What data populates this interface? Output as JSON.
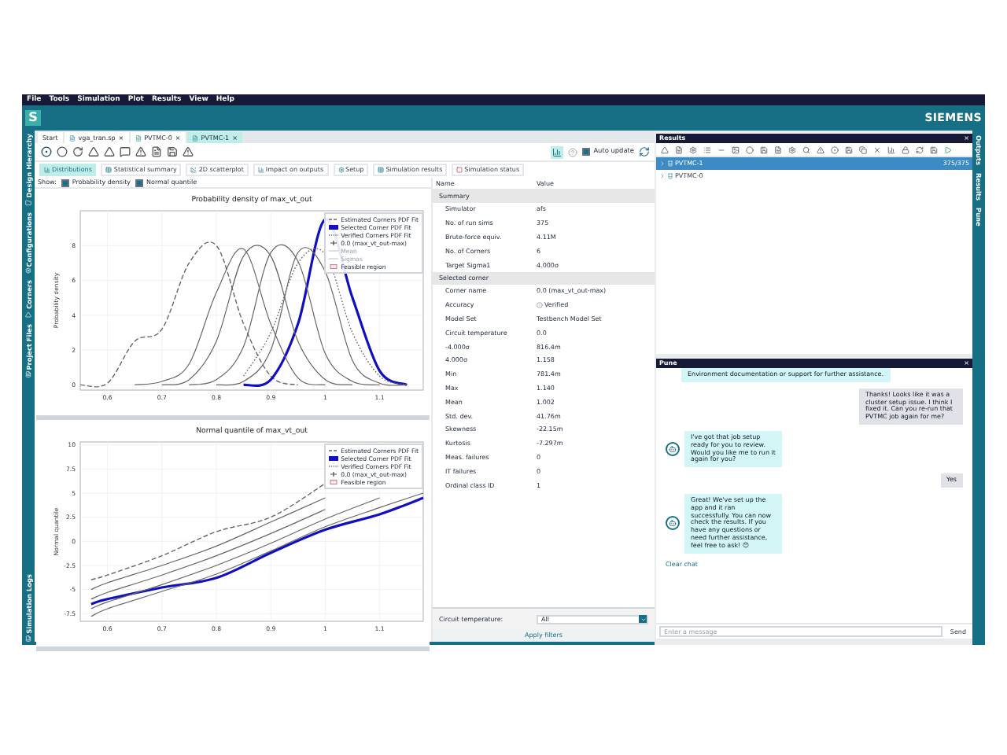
{
  "menu": [
    "File",
    "Tools",
    "Simulation",
    "Plot",
    "Results",
    "View",
    "Help"
  ],
  "header": {
    "logo": "S",
    "brand": "SIEMENS"
  },
  "left_sidebar": [
    "Design Hierarchy",
    "Configurations",
    "Corners",
    "Project Files",
    "Simulation Logs"
  ],
  "right_sidebar": [
    "Outputs",
    "Results",
    "Pune"
  ],
  "doc_tabs": [
    {
      "label": "Start",
      "selected": false
    },
    {
      "label": "vga_tran.sp",
      "close": "×",
      "selected": false
    },
    {
      "label": "PVTMC-0",
      "close": "×",
      "selected": false
    },
    {
      "label": "PVTMC-1",
      "close": "×",
      "selected": true
    }
  ],
  "auto_update": {
    "label": "Auto update",
    "checked": true
  },
  "view_tabs": [
    {
      "label": "Distributions",
      "selected": true
    },
    {
      "label": "Statistical summary",
      "selected": false
    },
    {
      "label": "2D scatterplot",
      "selected": false
    },
    {
      "label": "Impact on outputs",
      "selected": false
    },
    {
      "label": "Setup",
      "selected": false
    },
    {
      "label": "Simulation results",
      "selected": false
    },
    {
      "label": "Simulation status",
      "selected": false
    }
  ],
  "show": {
    "label": "Show:",
    "options": [
      {
        "label": "Probability density",
        "checked": true
      },
      {
        "label": "Normal quantile",
        "checked": true
      }
    ]
  },
  "charts": [
    {
      "chart_data": {
        "type": "line",
        "title": "Probability density of max_vt_out",
        "ylabel": "Probability density",
        "grid": true,
        "x": [
          0.55,
          0.6,
          0.65,
          0.7,
          0.75,
          0.8,
          0.85,
          0.9,
          0.95,
          1.0,
          1.05,
          1.1,
          1.15
        ],
        "xlim": [
          0.55,
          1.18
        ],
        "ylim": [
          -0.3,
          10
        ],
        "xticks": [
          {
            "value": 0.6,
            "label": "0.6"
          },
          {
            "value": 0.7,
            "label": "0.7"
          },
          {
            "value": 0.8,
            "label": "0.8"
          },
          {
            "value": 0.9,
            "label": "0.9"
          },
          {
            "value": 1,
            "label": "1"
          },
          {
            "value": 1.1,
            "label": "1.1"
          }
        ],
        "yticks": [
          0,
          2,
          4,
          6,
          8
        ],
        "series": [
          {
            "name": "Estimated Corners PDF Fit",
            "color": "#666666",
            "line_style": "dashed",
            "values": [
              0,
              0.1,
              2.5,
              3.2,
              7,
              8,
              3.5,
              0.5,
              0,
              null,
              null,
              null,
              null
            ]
          },
          {
            "name": "Selected Corner PDF Fit",
            "color": "#1010c0",
            "line_style": "solid",
            "values": [
              null,
              null,
              null,
              null,
              null,
              null,
              0,
              0.3,
              3.5,
              9.5,
              5,
              0.8,
              0
            ]
          },
          {
            "name": "Verified Corners PDF Fit",
            "color": "#666666",
            "line_style": "dotted",
            "values": [
              null,
              null,
              null,
              null,
              null,
              null,
              0.5,
              3,
              7,
              7.5,
              3,
              0.5,
              0
            ]
          },
          {
            "color": "#666666",
            "line_style": "solid",
            "values": [
              null,
              null,
              0,
              0.2,
              1.2,
              5.3,
              7.8,
              3.5,
              0.4,
              0,
              null,
              null,
              null
            ]
          },
          {
            "color": "#666666",
            "line_style": "solid",
            "values": [
              null,
              null,
              null,
              0,
              0.3,
              2.5,
              7.4,
              7.4,
              2.5,
              0.3,
              0,
              null,
              null
            ]
          },
          {
            "color": "#666666",
            "line_style": "solid",
            "values": [
              null,
              null,
              null,
              null,
              0,
              0.3,
              2.2,
              7.6,
              7.1,
              1.8,
              0.2,
              0,
              null
            ]
          },
          {
            "color": "#666666",
            "line_style": "solid",
            "values": [
              null,
              null,
              null,
              null,
              null,
              0,
              0.2,
              2,
              7.6,
              6.5,
              1.4,
              0.1,
              0
            ]
          }
        ]
      },
      "legend": [
        {
          "label": "0.0 (max_vt_out-max)",
          "kind": "marker"
        },
        {
          "label": "Mean",
          "kind": "faint"
        },
        {
          "label": "Sigmas",
          "kind": "faint"
        },
        {
          "label": "Feasible region",
          "kind": "box"
        }
      ]
    },
    {
      "chart_data": {
        "type": "line",
        "title": "Normal quantile of max_vt_out",
        "ylabel": "Normal quantile",
        "grid": true,
        "x": [
          0.57,
          0.6,
          0.7,
          0.8,
          0.9,
          1.0,
          1.1,
          1.18
        ],
        "xlim": [
          0.55,
          1.18
        ],
        "ylim": [
          -8.3,
          10.3
        ],
        "xticks": [
          {
            "value": 0.6,
            "label": "0.6"
          },
          {
            "value": 0.7,
            "label": "0.7"
          },
          {
            "value": 0.8,
            "label": "0.8"
          },
          {
            "value": 0.9,
            "label": "0.9"
          },
          {
            "value": 1,
            "label": "1"
          },
          {
            "value": 1.1,
            "label": "1.1"
          }
        ],
        "yticks": [
          -7.5,
          -5,
          -2.5,
          0,
          2.5,
          5,
          7.5,
          10
        ],
        "series": [
          {
            "name": "Estimated Corners PDF Fit",
            "color": "#666666",
            "line_style": "dashed",
            "values": [
              -4,
              -3.5,
              -1.5,
              1,
              2.5,
              6,
              null,
              null
            ]
          },
          {
            "name": "Selected Corner PDF Fit",
            "color": "#1010c0",
            "line_style": "solid",
            "values": [
              -6.5,
              -6,
              -4.8,
              -3.8,
              -1.2,
              1.2,
              2.8,
              4.5
            ]
          },
          {
            "color": "#666666",
            "line_style": "solid",
            "values": [
              -5,
              -4.3,
              -2.5,
              -0.5,
              2,
              4.5,
              null,
              null
            ]
          },
          {
            "color": "#666666",
            "line_style": "solid",
            "values": [
              -6,
              -5.3,
              -3.5,
              -1.5,
              0.8,
              3.3,
              null,
              null
            ]
          },
          {
            "color": "#666666",
            "line_style": "solid",
            "values": [
              -7,
              -6.3,
              -4.5,
              -2.5,
              -0.2,
              2.3,
              4.5,
              null
            ]
          },
          {
            "color": "#666666",
            "line_style": "solid",
            "values": [
              -7.8,
              -7,
              -5.2,
              -3.4,
              -1,
              1.5,
              3.5,
              5
            ]
          }
        ]
      },
      "legend": [
        {
          "label": "Verified Corners PDF Fit",
          "kind": "dotted"
        },
        {
          "label": "0.0 (max_vt_out-max)",
          "kind": "marker"
        },
        {
          "label": "Feasible region",
          "kind": "box"
        }
      ]
    }
  ],
  "table": {
    "columns": [
      "Name",
      "Value"
    ],
    "sections": [
      {
        "title": "Summary",
        "rows": [
          {
            "name": "Simulator",
            "value": "afs",
            "kind": "plain"
          },
          {
            "name": "No. of run sims",
            "value": "375",
            "kind": "plain"
          },
          {
            "name": "Brute-force equiv.",
            "value": "4.11M",
            "kind": "plain"
          },
          {
            "name": "No. of Corners",
            "value": "6",
            "kind": "plain"
          },
          {
            "name": "Target Sigma1",
            "value": "4.000σ",
            "kind": "plain"
          }
        ]
      },
      {
        "title": "Selected corner",
        "rows": [
          {
            "name": "Corner name",
            "value": "0.0 (max_vt_out-max)",
            "kind": "plain"
          },
          {
            "name": "Accuracy",
            "value": "Verified",
            "kind": "info"
          },
          {
            "name": "Model Set",
            "value": "Testbench Model Set",
            "kind": "plain"
          },
          {
            "name": "Circuit temperature",
            "value": "0.0",
            "kind": "plain"
          },
          {
            "name": "-4.000σ",
            "value": "816.4m",
            "kind": "plain"
          },
          {
            "name": "4.000σ",
            "value": "1.158",
            "kind": "plain"
          },
          {
            "name": "Min",
            "value": "781.4m",
            "kind": "plain"
          },
          {
            "name": "Max",
            "value": "1.140",
            "kind": "plain"
          },
          {
            "name": "Mean",
            "value": "1.002",
            "kind": "plain"
          },
          {
            "name": "Std. dev.",
            "value": "41.76m",
            "kind": "plain"
          },
          {
            "name": "Skewness",
            "value": "-22.15m",
            "kind": "plain"
          },
          {
            "name": "Kurtosis",
            "value": "-7.297m",
            "kind": "plain"
          },
          {
            "name": "Meas. failures",
            "value": "0",
            "kind": "plain"
          },
          {
            "name": "IT failures",
            "value": "0",
            "kind": "plain"
          },
          {
            "name": "Ordinal class ID",
            "value": "1",
            "kind": "plain"
          }
        ]
      }
    ]
  },
  "filter": {
    "label": "Circuit temperature:",
    "value": "All"
  },
  "apply_button": "Apply filters",
  "results": {
    "title": "Results",
    "close": "×",
    "rows": [
      {
        "label": "PVTMC-1",
        "count": "375/375",
        "selected": true
      },
      {
        "label": "PVTMC-0",
        "selected": false
      }
    ]
  },
  "chat": {
    "title": "Pune",
    "close": "×",
    "messages": [
      {
        "kind": "bot",
        "avatar": false,
        "text": "Environment documentation or support for further assistance."
      },
      {
        "kind": "user",
        "text": "Thanks!  Looks like it was a cluster setup issue.  I think I fixed it.  Can you re-run that PVTMC job again for me?"
      },
      {
        "kind": "bot",
        "avatar": true,
        "text": "I've got that job setup ready for you to review. Would you like me to run it again for you?"
      },
      {
        "kind": "user",
        "text": "Yes"
      },
      {
        "kind": "bot",
        "avatar": true,
        "text": "Great! We've set up the app and it ran successfully. You can now check the results. If you have any questions or need further assistance, feel free to ask! 😊"
      }
    ],
    "clear": "Clear chat",
    "placeholder": "Enter a message",
    "send": "Send"
  }
}
